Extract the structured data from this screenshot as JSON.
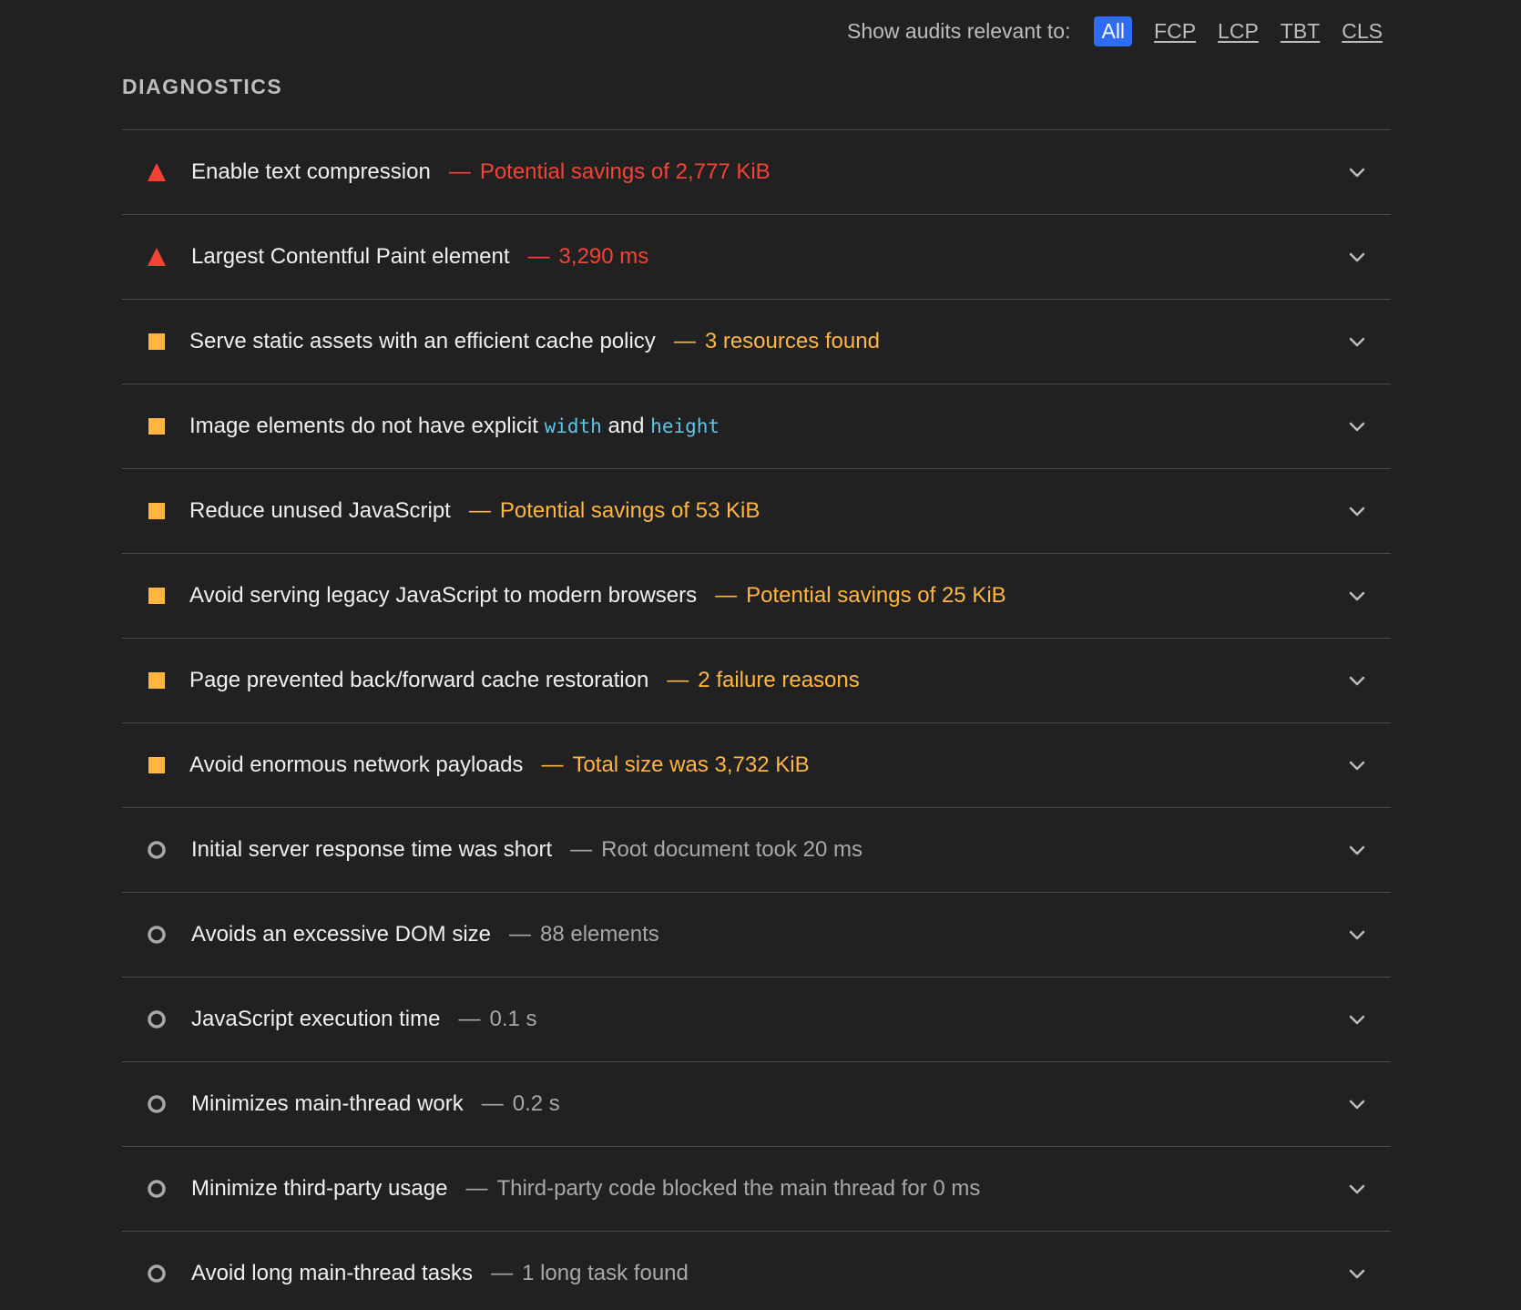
{
  "filters": {
    "label": "Show audits relevant to:",
    "options": [
      "All",
      "FCP",
      "LCP",
      "TBT",
      "CLS"
    ],
    "active": "All"
  },
  "section_title": "DIAGNOSTICS",
  "colors": {
    "fail": "#f44336",
    "average": "#ffb53e",
    "pass": "#a8a8a8",
    "active_filter": "#2f6cf6",
    "code": "#5fc4e6"
  },
  "audits": [
    {
      "severity": "fail",
      "icon": "triangle-warning-icon",
      "title": "Enable text compression",
      "detail": "Potential savings of 2,777 KiB"
    },
    {
      "severity": "fail",
      "icon": "triangle-warning-icon",
      "title": "Largest Contentful Paint element",
      "detail": "3,290 ms"
    },
    {
      "severity": "average",
      "icon": "square-average-icon",
      "title": "Serve static assets with an efficient cache policy",
      "detail": "3 resources found"
    },
    {
      "severity": "average",
      "icon": "square-average-icon",
      "title_parts": [
        "Image elements do not have explicit ",
        "width",
        " and ",
        "height"
      ],
      "detail": ""
    },
    {
      "severity": "average",
      "icon": "square-average-icon",
      "title": "Reduce unused JavaScript",
      "detail": "Potential savings of 53 KiB"
    },
    {
      "severity": "average",
      "icon": "square-average-icon",
      "title": "Avoid serving legacy JavaScript to modern browsers",
      "detail": "Potential savings of 25 KiB"
    },
    {
      "severity": "average",
      "icon": "square-average-icon",
      "title": "Page prevented back/forward cache restoration",
      "detail": "2 failure reasons"
    },
    {
      "severity": "average",
      "icon": "square-average-icon",
      "title": "Avoid enormous network payloads",
      "detail": "Total size was 3,732 KiB"
    },
    {
      "severity": "pass",
      "icon": "circle-info-icon",
      "title": "Initial server response time was short",
      "detail": "Root document took 20 ms"
    },
    {
      "severity": "pass",
      "icon": "circle-info-icon",
      "title": "Avoids an excessive DOM size",
      "detail": "88 elements"
    },
    {
      "severity": "pass",
      "icon": "circle-info-icon",
      "title": "JavaScript execution time",
      "detail": "0.1 s"
    },
    {
      "severity": "pass",
      "icon": "circle-info-icon",
      "title": "Minimizes main-thread work",
      "detail": "0.2 s"
    },
    {
      "severity": "pass",
      "icon": "circle-info-icon",
      "title": "Minimize third-party usage",
      "detail": "Third-party code blocked the main thread for 0 ms"
    },
    {
      "severity": "pass",
      "icon": "circle-info-icon",
      "title": "Avoid long main-thread tasks",
      "detail": "1 long task found"
    }
  ],
  "separator": "—",
  "expand_icon": "chevron-down-icon"
}
